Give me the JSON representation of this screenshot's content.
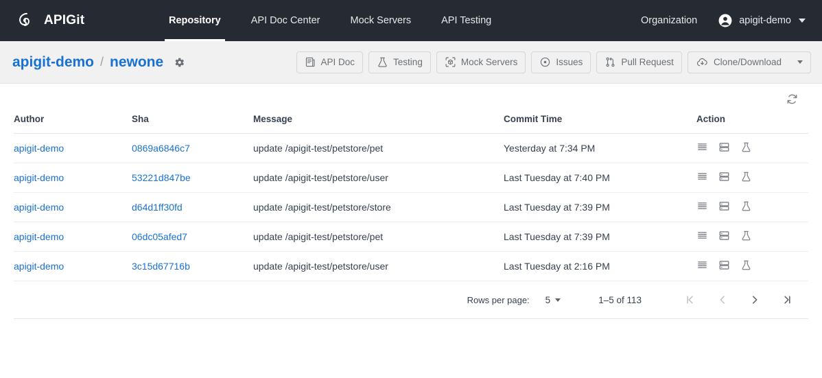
{
  "topnav": {
    "brand": "APIGit",
    "brand_logo_icon": "apigit-logo-icon",
    "items": [
      {
        "label": "Repository",
        "active": true
      },
      {
        "label": "API Doc Center",
        "active": false
      },
      {
        "label": "Mock Servers",
        "active": false
      },
      {
        "label": "API Testing",
        "active": false
      }
    ],
    "organization": "Organization",
    "user": "apigit-demo",
    "user_icon": "account-circle-icon",
    "caret_icon": "chevron-down-icon"
  },
  "subheader": {
    "owner": "apigit-demo",
    "separator": "/",
    "repo": "newone",
    "settings_icon": "gear-icon",
    "buttons": [
      {
        "label": "API Doc",
        "icon": "api-doc-icon"
      },
      {
        "label": "Testing",
        "icon": "flask-icon"
      },
      {
        "label": "Mock Servers",
        "icon": "cube-scan-icon"
      },
      {
        "label": "Issues",
        "icon": "issue-dot-circle-icon"
      },
      {
        "label": "Pull Request",
        "icon": "pull-request-icon"
      },
      {
        "label": "Clone/Download",
        "icon": "cloud-download-icon",
        "caret": true
      }
    ]
  },
  "toolbar": {
    "refresh_icon": "refresh-icon"
  },
  "table": {
    "columns": [
      "Author",
      "Sha",
      "Message",
      "Commit Time",
      "Action"
    ],
    "row_action_icons": [
      "commit-detail-list-icon",
      "mock-server-icon",
      "testing-flask-icon"
    ],
    "rows": [
      {
        "author": "apigit-demo",
        "sha": "0869a6846c7",
        "message": "update /apigit-test/petstore/pet",
        "commit_time": "Yesterday at 7:34 PM"
      },
      {
        "author": "apigit-demo",
        "sha": "53221d847be",
        "message": "update /apigit-test/petstore/user",
        "commit_time": "Last Tuesday at 7:40 PM"
      },
      {
        "author": "apigit-demo",
        "sha": "d64d1ff30fd",
        "message": "update /apigit-test/petstore/store",
        "commit_time": "Last Tuesday at 7:39 PM"
      },
      {
        "author": "apigit-demo",
        "sha": "06dc05afed7",
        "message": "update /apigit-test/petstore/pet",
        "commit_time": "Last Tuesday at 7:39 PM"
      },
      {
        "author": "apigit-demo",
        "sha": "3c15d67716b",
        "message": "update /apigit-test/petstore/user",
        "commit_time": "Last Tuesday at 2:16 PM"
      }
    ]
  },
  "pagination": {
    "rows_per_page_label": "Rows per page:",
    "rows_per_page_value": "5",
    "range_label": "1–5 of 113",
    "first_page_icon": "first-page-icon",
    "prev_page_icon": "chevron-left-icon",
    "next_page_icon": "chevron-right-icon",
    "last_page_icon": "last-page-icon"
  },
  "colors": {
    "topbar_bg": "#262b33",
    "subheader_bg": "#f1f1f1",
    "link_blue": "#1971d2",
    "text_dark": "#37414f",
    "muted": "#6b7075"
  }
}
